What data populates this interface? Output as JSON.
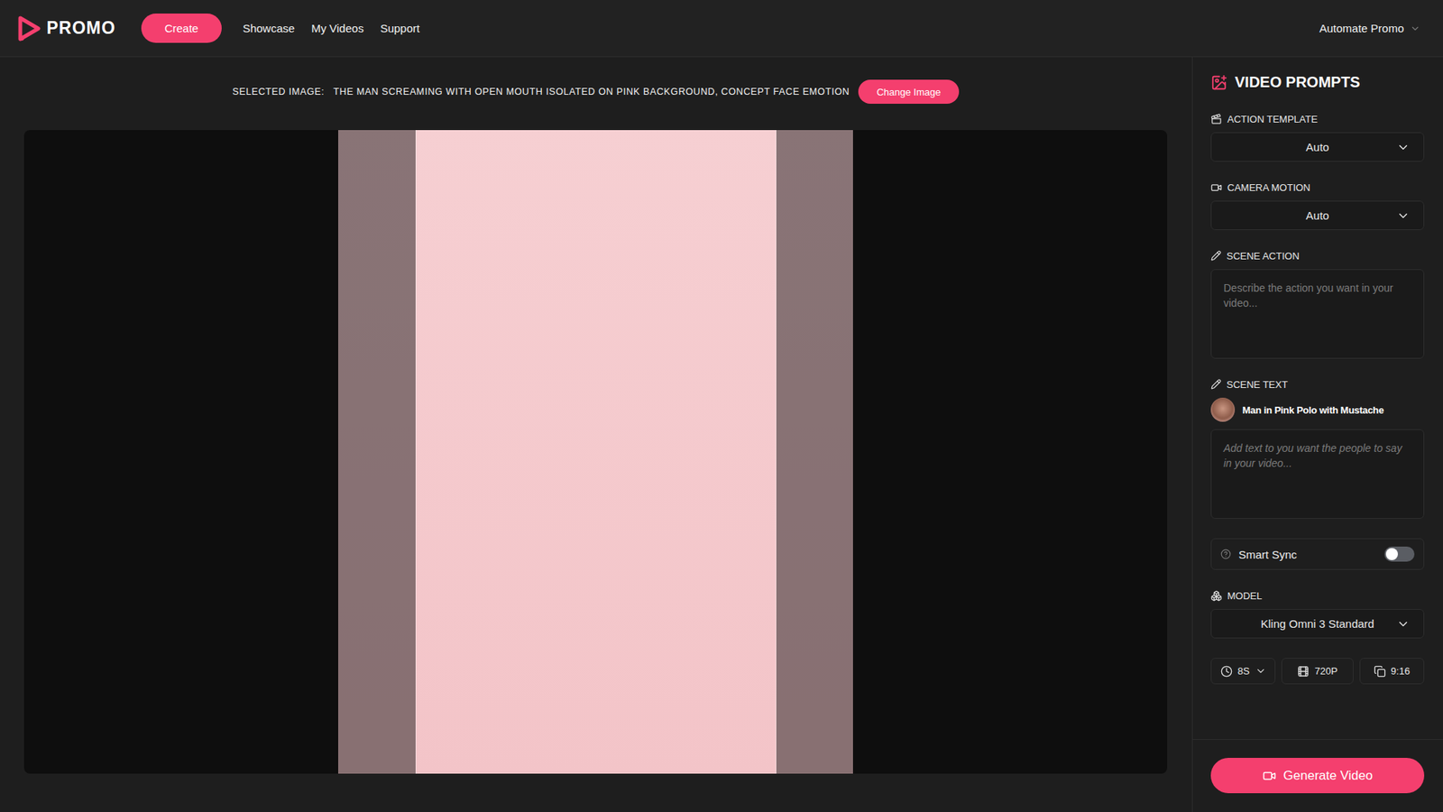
{
  "header": {
    "logo": "PROMO",
    "create_button": "Create",
    "nav": [
      "Showcase",
      "My Videos",
      "Support"
    ],
    "account": "Automate Promo"
  },
  "selected_image": {
    "label": "SELECTED IMAGE:",
    "title": "THE MAN SCREAMING WITH OPEN MOUTH ISOLATED ON PINK BACKGROUND, CONCEPT FACE EMOTION",
    "change_button": "Change Image"
  },
  "panel": {
    "title": "VIDEO PROMPTS",
    "action_template": {
      "label": "ACTION TEMPLATE",
      "value": "Auto"
    },
    "camera_motion": {
      "label": "CAMERA MOTION",
      "value": "Auto"
    },
    "scene_action": {
      "label": "SCENE ACTION",
      "placeholder": "Describe the action you want in your video..."
    },
    "scene_text": {
      "label": "SCENE TEXT",
      "character": "Man in Pink Polo with Mustache",
      "placeholder": "Add text to you want the people to say in your video..."
    },
    "smart_sync": {
      "label": "Smart Sync",
      "on": false
    },
    "model": {
      "label": "MODEL",
      "value": "Kling Omni 3 Standard"
    },
    "settings": [
      {
        "kind": "duration",
        "value": "8S"
      },
      {
        "kind": "resolution",
        "value": "720P"
      },
      {
        "kind": "aspect",
        "value": "9:16"
      }
    ],
    "generate_button": "Generate Video"
  }
}
